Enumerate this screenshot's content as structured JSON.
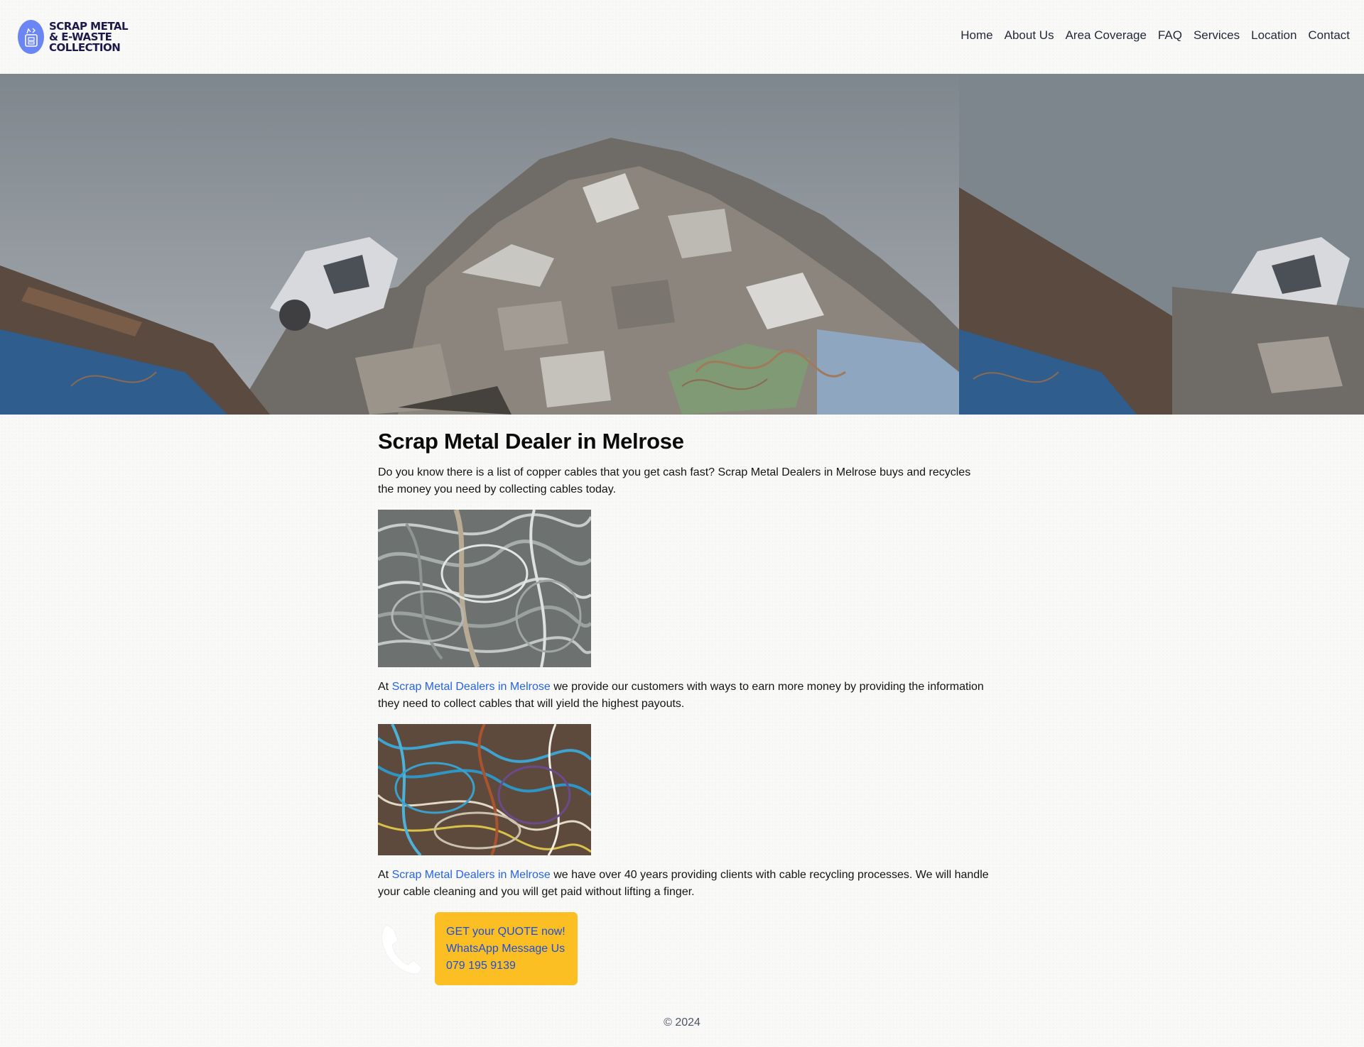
{
  "brand": {
    "logo_line1": "SCRAP METAL",
    "logo_line2": "& E-WASTE",
    "logo_line3": "COLLECTION",
    "accent": "#6b86f2",
    "text_color": "#1c1a4a"
  },
  "nav": {
    "items": [
      "Home",
      "About Us",
      "Area Coverage",
      "FAQ",
      "Services",
      "Location",
      "Contact"
    ]
  },
  "hero": {
    "image": "scrap-metal-pile"
  },
  "main": {
    "title": "Scrap Metal Dealer in Melrose",
    "intro": "Do you know there is a list of copper cables that you get cash fast? Scrap Metal Dealers in Melrose buys and recycles the money you need by collecting cables today.",
    "image1": "grey-cables-pile",
    "para2": {
      "prefix": "At ",
      "link": "Scrap Metal Dealers in Melrose",
      "suffix": " we provide our customers with ways to earn more money by providing the information they need to collect cables that will yield the highest payouts."
    },
    "image2": "colored-wires-pile",
    "para3": {
      "prefix": "At ",
      "link": "Scrap Metal Dealers in Melrose",
      "suffix": " we have over 40 years providing clients with cable recycling processes. We will handle your cable cleaning and you will get paid without lifting a finger."
    },
    "cta": {
      "line1": "GET your QUOTE now!",
      "line2": "WhatsApp Message Us",
      "line3": "079 195 9139",
      "bg": "#fbbf24",
      "text_color": "#1d4ed8"
    }
  },
  "footer": {
    "text": "© 2024"
  }
}
